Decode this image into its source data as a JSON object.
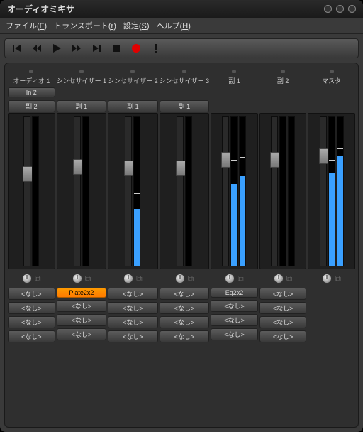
{
  "title": "オーディオミキサ",
  "menu": {
    "file": "ファイル",
    "file_a": "F",
    "transport": "トランスポート",
    "transport_a": "r",
    "settings": "設定",
    "settings_a": "S",
    "help": "ヘルプ",
    "help_a": "H"
  },
  "strips": [
    {
      "label": "オーディオ 1",
      "in": "In 2",
      "send": "副 2",
      "fader": 70,
      "meter": 0,
      "peak": null,
      "fx": [
        "<なし>",
        "<なし>",
        "<なし>",
        "<なし>"
      ]
    },
    {
      "label": "シンセサイザー 1",
      "in": "",
      "send": "副 1",
      "fader": 60,
      "meter": 0,
      "peak": null,
      "fx": [
        "Plate2x2",
        "<なし>",
        "<なし>",
        "<なし>"
      ],
      "fxHighlight": 0
    },
    {
      "label": "シンセサイザー 2",
      "in": "",
      "send": "副 1",
      "fader": 62,
      "meter": 38,
      "peak": 48,
      "fx": [
        "<なし>",
        "<なし>",
        "<なし>",
        "<なし>"
      ]
    },
    {
      "label": "シンセサイザー 3",
      "in": "",
      "send": "副 1",
      "fader": 62,
      "meter": 0,
      "peak": null,
      "fx": [
        "<なし>",
        "<なし>",
        "<なし>",
        "<なし>"
      ]
    },
    {
      "label": "副 1",
      "in": "",
      "send": "",
      "fader": 50,
      "meterL": 55,
      "meterR": 60,
      "peakL": 70,
      "peakR": 72,
      "stereo": true,
      "fx": [
        "Eq2x2",
        "<なし>",
        "<なし>",
        "<なし>"
      ]
    },
    {
      "label": "副 2",
      "in": "",
      "send": "",
      "fader": 50,
      "meterL": 0,
      "meterR": 0,
      "peakL": null,
      "peakR": null,
      "stereo": true,
      "fx": [
        "<なし>",
        "<なし>",
        "<なし>",
        "<なし>"
      ]
    },
    {
      "label": "マスタ",
      "in": "",
      "send": "",
      "fader": 45,
      "meterL": 62,
      "meterR": 74,
      "peakL": 70,
      "peakR": 78,
      "stereo": true,
      "fx": [
        "",
        "",
        "",
        ""
      ]
    }
  ],
  "fxEmpty": "<なし>"
}
